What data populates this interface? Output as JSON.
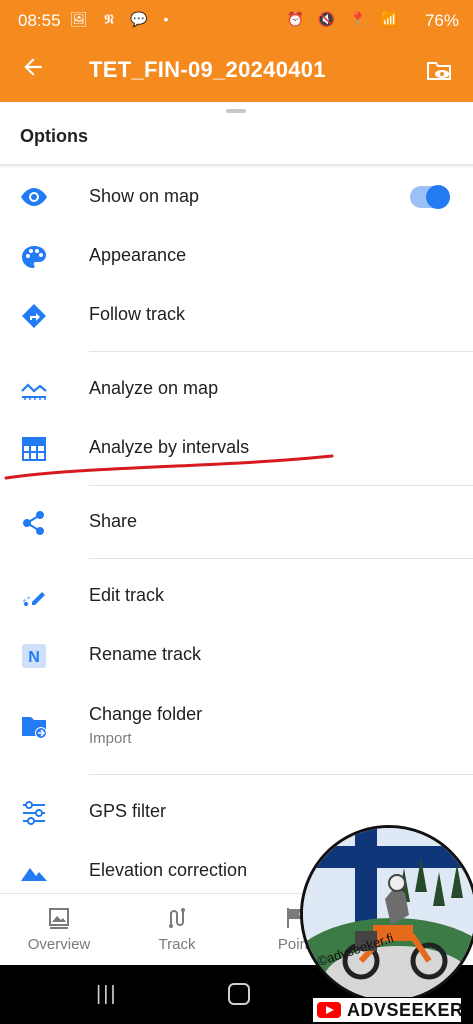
{
  "status_bar": {
    "time": "08:55",
    "left_icons": "🖼 𝕹 💬 •",
    "right_icons": "⏰ 🔇 📍 📶",
    "battery": "76%"
  },
  "app_bar": {
    "back_icon": "arrow-left-icon",
    "title": "TET_FIN-09_20240401",
    "action_icon": "folder-eye-icon"
  },
  "sheet": {
    "title": "Options"
  },
  "menu": {
    "show_on_map": {
      "label": "Show on map",
      "icon": "eye-icon",
      "toggle_on": true
    },
    "appearance": {
      "label": "Appearance",
      "icon": "palette-icon"
    },
    "follow_track": {
      "label": "Follow track",
      "icon": "direction-diamond-icon"
    },
    "analyze_on_map": {
      "label": "Analyze on map",
      "icon": "chart-icon"
    },
    "analyze_by_intervals": {
      "label": "Analyze by intervals",
      "icon": "grid-table-icon"
    },
    "share": {
      "label": "Share",
      "icon": "share-icon"
    },
    "edit_track": {
      "label": "Edit track",
      "icon": "edit-track-icon"
    },
    "rename_track": {
      "label": "Rename track",
      "icon": "rename-n-icon"
    },
    "change_folder": {
      "label": "Change folder",
      "sublabel": "Import",
      "icon": "folder-move-icon"
    },
    "gps_filter": {
      "label": "GPS filter",
      "icon": "sliders-icon"
    },
    "elevation_correction": {
      "label": "Elevation correction",
      "icon": "mountain-icon"
    }
  },
  "bottom_nav": {
    "overview": "Overview",
    "track": "Track",
    "points": "Point"
  },
  "watermark": {
    "circle_text": "©advseeker.fi",
    "youtube_text": "ADVSEEKER"
  },
  "colors": {
    "brand_orange": "#f58a1f",
    "icon_blue": "#237bf3",
    "annotation_red": "#d71920"
  }
}
